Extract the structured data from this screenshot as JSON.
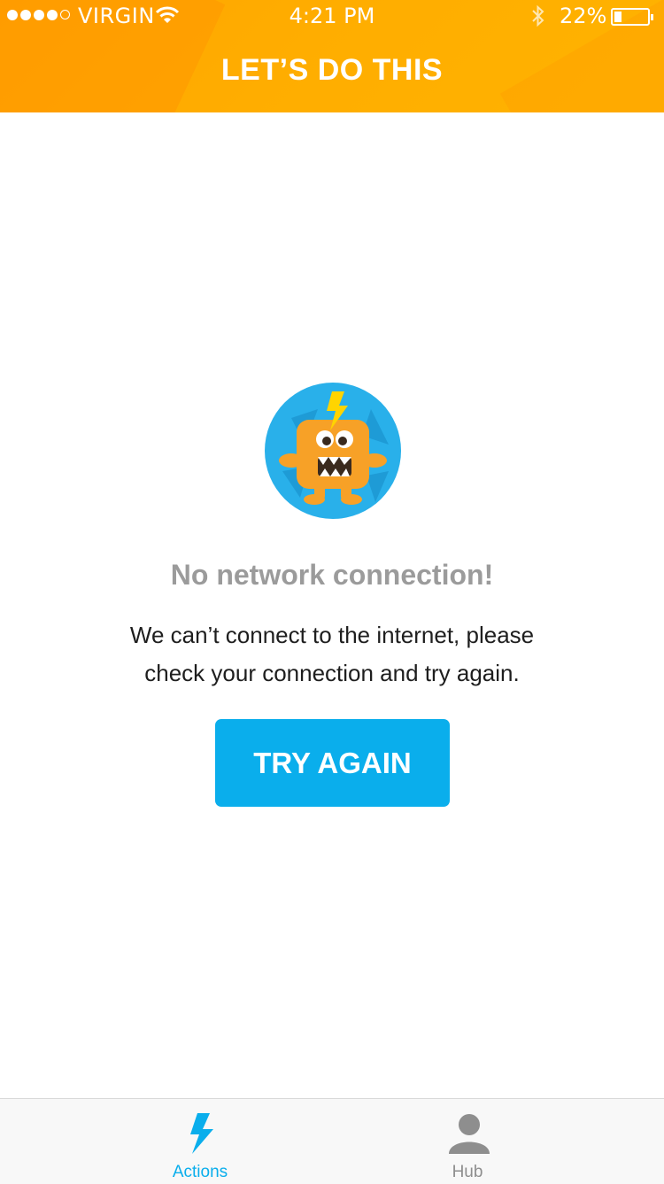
{
  "status_bar": {
    "carrier": "VIRGIN",
    "time": "4:21 PM",
    "battery_percent": "22%",
    "battery_level": 0.22,
    "signal_bars": 4,
    "signal_max": 5
  },
  "header": {
    "title": "LET’S DO THIS"
  },
  "error": {
    "heading": "No network connection!",
    "message": "We can’t connect to the internet, please check your connection and try again.",
    "button_label": "TRY AGAIN"
  },
  "tabs": [
    {
      "label": "Actions",
      "icon": "lightning-icon",
      "active": true
    },
    {
      "label": "Hub",
      "icon": "person-icon",
      "active": false
    }
  ],
  "colors": {
    "header": "#FFAD00",
    "accent": "#0AAEEC",
    "mascot_bg": "#29B0EA",
    "mascot_body": "#F7A127"
  }
}
